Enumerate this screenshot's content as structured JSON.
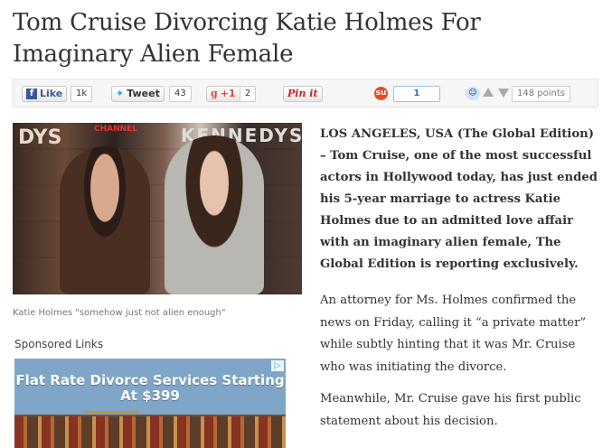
{
  "headline": "Tom Cruise Divorcing Katie Holmes For Imaginary Alien Female",
  "share": {
    "facebook_label": "Like",
    "facebook_count": "1k",
    "twitter_label": "Tweet",
    "twitter_count": "43",
    "gplus_label": "+1",
    "gplus_count": "2",
    "pinterest_label": "Pin it",
    "stumble_count": "1",
    "reddit_points": "148 points"
  },
  "photo": {
    "caption": "Katie Holmes \"somehow just not alien enough\""
  },
  "sponsored": {
    "heading": "Sponsored Links",
    "ad_text": "Flat Rate Divorce Services Starting At $399"
  },
  "article": {
    "lede": "LOS ANGELES, USA (The Global Edition) – Tom Cruise, one of the most successful actors in Hollywood today, has just ended his 5-year marriage to actress Katie Holmes due to an admitted love affair with an imaginary alien female, The Global Edition is reporting exclusively.",
    "para1": "An attorney for Ms. Holmes confirmed the news on Friday, calling it “a private matter” while subtly hinting that it was Mr. Cruise who was initiating the divorce.",
    "para2": "Meanwhile, Mr. Cruise gave his first public statement about his decision."
  },
  "colors": {
    "facebook": "#3b5998",
    "twitter": "#2aa9e0",
    "gplus": "#dd4b39",
    "pinterest": "#cb2027",
    "stumble": "#eb4924"
  }
}
